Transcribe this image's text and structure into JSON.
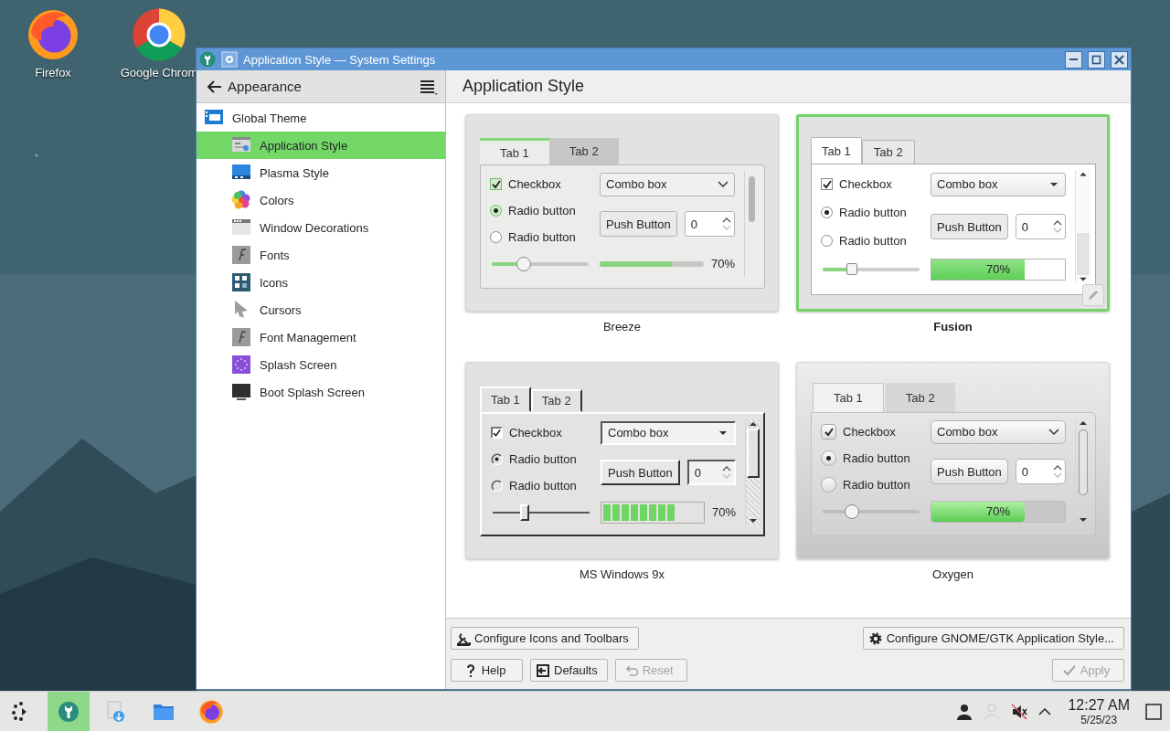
{
  "desktop": {
    "icons": [
      {
        "label": "Firefox",
        "kind": "firefox"
      },
      {
        "label": "Google Chrom",
        "kind": "chrome"
      }
    ]
  },
  "window": {
    "title": "Application Style — System Settings"
  },
  "sidebar": {
    "header": "Appearance",
    "items": [
      {
        "label": "Global Theme",
        "kind": "global-theme",
        "selected": false,
        "children": [
          {
            "label": "Application Style",
            "kind": "app-style",
            "selected": true
          },
          {
            "label": "Plasma Style",
            "kind": "plasma",
            "selected": false
          },
          {
            "label": "Colors",
            "kind": "colors",
            "selected": false
          },
          {
            "label": "Window Decorations",
            "kind": "decorations",
            "selected": false
          },
          {
            "label": "Fonts",
            "kind": "fonts",
            "selected": false
          },
          {
            "label": "Icons",
            "kind": "icons",
            "selected": false
          },
          {
            "label": "Cursors",
            "kind": "cursors",
            "selected": false
          },
          {
            "label": "Font Management",
            "kind": "fonts",
            "selected": false
          },
          {
            "label": "Splash Screen",
            "kind": "splash",
            "selected": false
          },
          {
            "label": "Boot Splash Screen",
            "kind": "boot",
            "selected": false
          }
        ]
      }
    ]
  },
  "page": {
    "title": "Application Style",
    "styles": [
      {
        "name": "Breeze",
        "kind": "breeze",
        "selected": false,
        "settings_button": false,
        "tabs": [
          {
            "label": "Tab 1",
            "selected": true
          },
          {
            "label": "Tab 2",
            "selected": false
          }
        ],
        "checkbox": {
          "label": "Checkbox",
          "checked": true
        },
        "radios": [
          {
            "label": "Radio button",
            "selected": true
          },
          {
            "label": "Radio button",
            "selected": false
          }
        ],
        "combo": "Combo box",
        "button": "Push Button",
        "spin": "0",
        "slider": {
          "level": 0.33
        },
        "progress": {
          "level": 0.7,
          "label": "70%"
        }
      },
      {
        "name": "Fusion",
        "kind": "fusion",
        "selected": true,
        "settings_button": true,
        "tabs": [
          {
            "label": "Tab 1",
            "selected": true
          },
          {
            "label": "Tab 2",
            "selected": false
          }
        ],
        "checkbox": {
          "label": "Checkbox",
          "checked": true
        },
        "radios": [
          {
            "label": "Radio button",
            "selected": true
          },
          {
            "label": "Radio button",
            "selected": false
          }
        ],
        "combo": "Combo box",
        "button": "Push Button",
        "spin": "0",
        "slider": {
          "level": 0.3
        },
        "progress": {
          "level": 0.7,
          "label": "70%"
        }
      },
      {
        "name": "MS Windows 9x",
        "kind": "windows9x",
        "selected": false,
        "settings_button": false,
        "tabs": [
          {
            "label": "Tab 1",
            "selected": true
          },
          {
            "label": "Tab 2",
            "selected": false
          }
        ],
        "checkbox": {
          "label": "Checkbox",
          "checked": true
        },
        "radios": [
          {
            "label": "Radio button",
            "selected": true
          },
          {
            "label": "Radio button",
            "selected": false
          }
        ],
        "combo": "Combo box",
        "button": "Push Button",
        "spin": "0",
        "slider": {
          "level": 0.33
        },
        "progress": {
          "level": 0.7,
          "label": "70%"
        }
      },
      {
        "name": "Oxygen",
        "kind": "oxygen",
        "selected": false,
        "settings_button": false,
        "tabs": [
          {
            "label": "Tab 1",
            "selected": true
          },
          {
            "label": "Tab 2",
            "selected": false
          }
        ],
        "checkbox": {
          "label": "Checkbox",
          "checked": true
        },
        "radios": [
          {
            "label": "Radio button",
            "selected": true
          },
          {
            "label": "Radio button",
            "selected": false
          }
        ],
        "combo": "Combo box",
        "button": "Push Button",
        "spin": "0",
        "slider": {
          "level": 0.3
        },
        "progress": {
          "level": 0.7,
          "label": "70%"
        }
      }
    ]
  },
  "buttons": [
    {
      "label": "Configure Icons and Toolbars",
      "kind": "toolbars",
      "disabled": false
    },
    {
      "label": "Configure GNOME/GTK Application Style...",
      "kind": "gtk",
      "disabled": false
    },
    {
      "label": "Help",
      "kind": "help",
      "disabled": false
    },
    {
      "label": "Defaults",
      "kind": "defaults",
      "disabled": false
    },
    {
      "label": "Reset",
      "kind": "reset",
      "disabled": true
    },
    {
      "label": "Apply",
      "kind": "apply",
      "disabled": true
    }
  ],
  "taskbar": {
    "items": [
      {
        "kind": "launcher",
        "active": false
      },
      {
        "kind": "settings",
        "active": true
      },
      {
        "kind": "downloads",
        "active": false
      },
      {
        "kind": "files",
        "active": false
      },
      {
        "kind": "firefox",
        "active": false
      }
    ],
    "clock": {
      "time": "12:27 AM",
      "date": "5/25/23"
    }
  }
}
